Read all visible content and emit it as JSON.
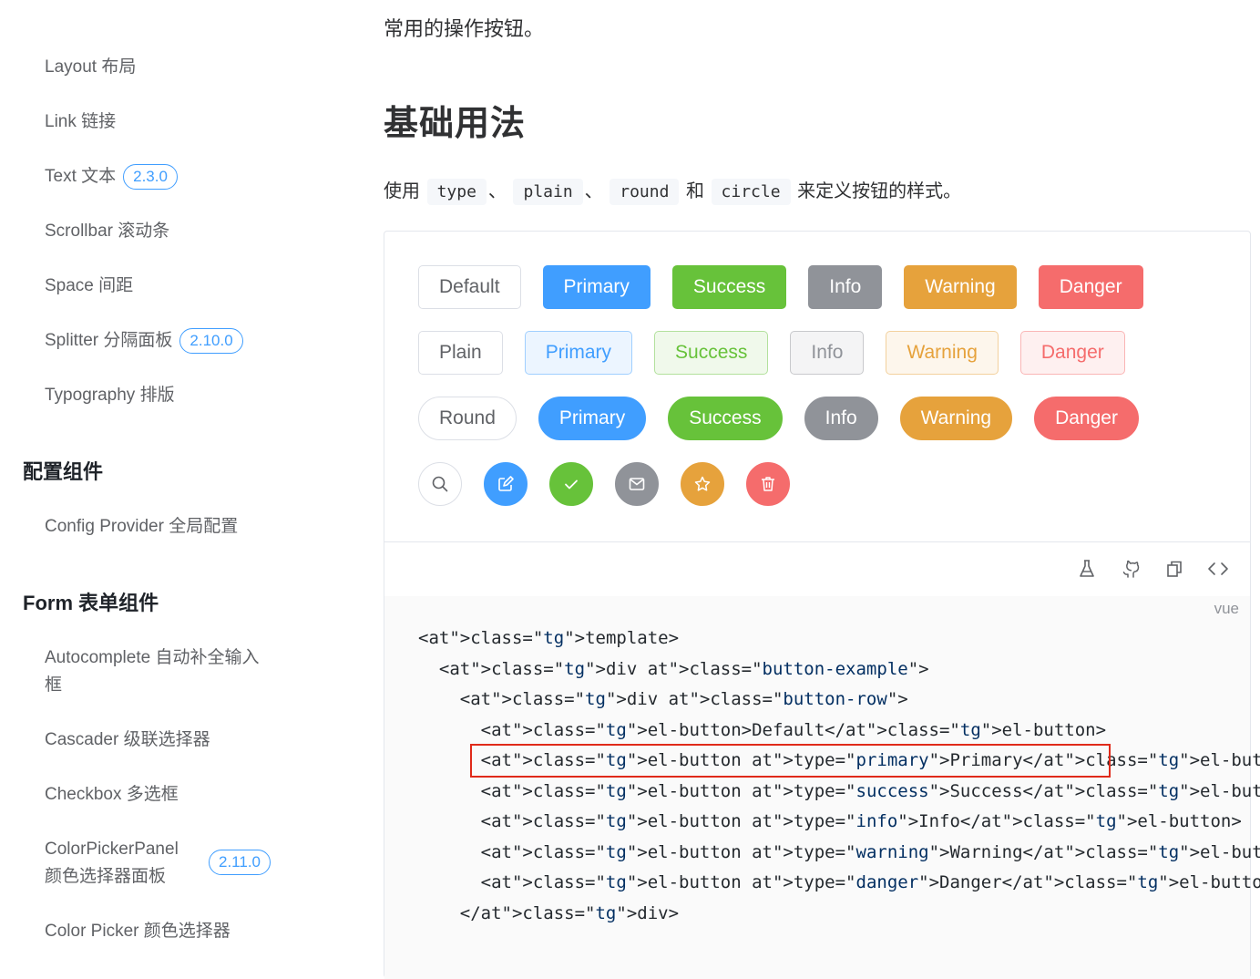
{
  "sidebar": {
    "items": [
      {
        "label": "Layout 布局"
      },
      {
        "label": "Link 链接"
      },
      {
        "label": "Text 文本",
        "badge": "2.3.0"
      },
      {
        "label": "Scrollbar 滚动条"
      },
      {
        "label": "Space 间距"
      },
      {
        "label": "Splitter 分隔面板",
        "badge": "2.10.0"
      },
      {
        "label": "Typography 排版"
      }
    ],
    "group_config": "配置组件",
    "config_items": [
      {
        "label": "Config Provider 全局配置"
      }
    ],
    "group_form": "Form 表单组件",
    "form_items": [
      {
        "label": "Autocomplete 自动补全输入框"
      },
      {
        "label": "Cascader 级联选择器"
      },
      {
        "label": "Checkbox 多选框"
      },
      {
        "label": "ColorPickerPanel 颜色选择器面板",
        "badge": "2.11.0"
      },
      {
        "label": "Color Picker 颜色选择器"
      }
    ]
  },
  "main": {
    "intro": "常用的操作按钮。",
    "heading": "基础用法",
    "desc_prefix": "使用",
    "desc_codes": [
      "type",
      "plain",
      "round",
      "circle"
    ],
    "desc_sep": "、",
    "desc_and": "和",
    "desc_suffix": "来定义按钮的样式。"
  },
  "demo": {
    "row_default": [
      "Default",
      "Primary",
      "Success",
      "Info",
      "Warning",
      "Danger"
    ],
    "row_plain": [
      "Plain",
      "Primary",
      "Success",
      "Info",
      "Warning",
      "Danger"
    ],
    "row_round": [
      "Round",
      "Primary",
      "Success",
      "Info",
      "Warning",
      "Danger"
    ],
    "row_circle_icons": [
      "search-icon",
      "edit-icon",
      "check-icon",
      "message-icon",
      "star-icon",
      "delete-icon"
    ],
    "colors": {
      "primary": "#409eff",
      "success": "#67c23a",
      "info": "#909399",
      "warning": "#e6a23c",
      "danger": "#f56c6c",
      "highlight": "#e02a1a"
    }
  },
  "toolbar": {
    "icons": [
      "playground-icon",
      "github-icon",
      "copy-icon",
      "code-icon"
    ]
  },
  "code": {
    "lang": "vue",
    "lines": [
      "<template>",
      "  <div class=\"button-example\">",
      "    <div class=\"button-row\">",
      "      <el-button>Default</el-button>",
      "      <el-button type=\"primary\">Primary</el-button>",
      "      <el-button type=\"success\">Success</el-button>",
      "      <el-button type=\"info\">Info</el-button>",
      "      <el-button type=\"warning\">Warning</el-button>",
      "      <el-button type=\"danger\">Danger</el-button>",
      "    </div>"
    ]
  }
}
